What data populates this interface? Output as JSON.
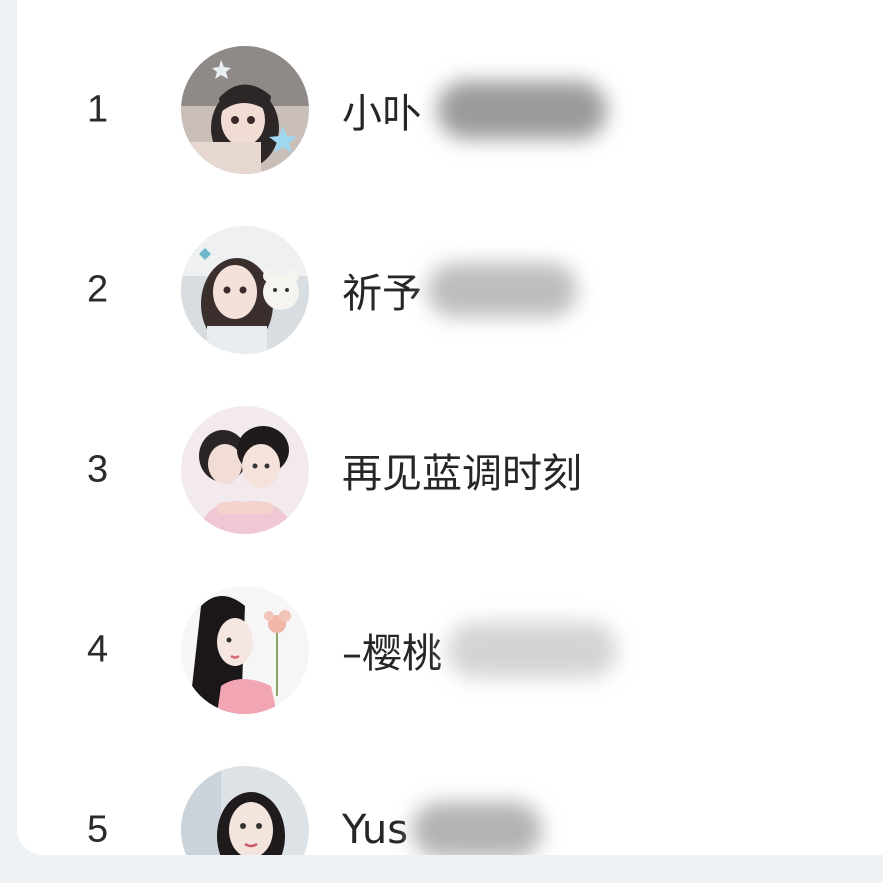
{
  "ranking": {
    "items": [
      {
        "rank": "1",
        "name": "小卟",
        "avatar": "avatar-girl-star-icon"
      },
      {
        "rank": "2",
        "name": "祈予",
        "avatar": "avatar-girl-bear-icon"
      },
      {
        "rank": "3",
        "name": "再见蓝调时刻",
        "avatar": "avatar-couple-icon"
      },
      {
        "rank": "4",
        "name": "–樱桃",
        "avatar": "avatar-girl-flower-icon"
      },
      {
        "rank": "5",
        "name": "Yus",
        "avatar": "avatar-girl-portrait-icon"
      }
    ]
  }
}
